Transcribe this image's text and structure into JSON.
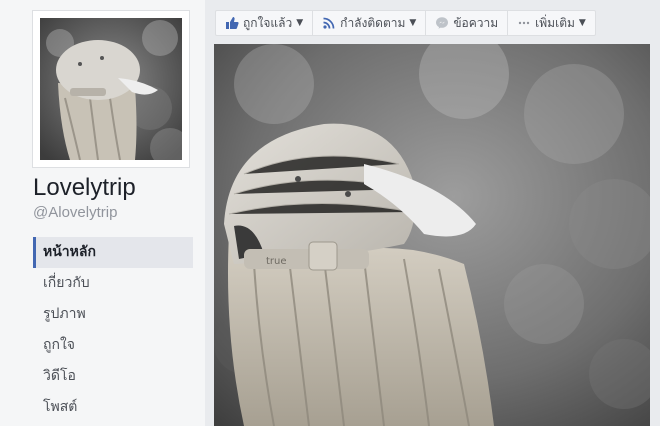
{
  "page": {
    "name": "Lovelytrip",
    "handle": "@Alovelytrip"
  },
  "toolbar": {
    "like_label": "ถูกใจแล้ว",
    "follow_label": "กำลังติดตาม",
    "message_label": "ข้อความ",
    "more_label": "เพิ่มเติม"
  },
  "nav": {
    "items": [
      {
        "label": "หน้าหลัก"
      },
      {
        "label": "เกี่ยวกับ"
      },
      {
        "label": "รูปภาพ"
      },
      {
        "label": "ถูกใจ"
      },
      {
        "label": "วิดีโอ"
      },
      {
        "label": "โพสต์"
      }
    ]
  },
  "cover": {
    "cap_text": "true"
  },
  "icons": {
    "like": "thumbs-up-icon",
    "follow": "rss-icon",
    "message": "messenger-icon",
    "more": "ellipsis-icon"
  },
  "colors": {
    "accent": "#4267b2",
    "background": "#e9ebee"
  }
}
